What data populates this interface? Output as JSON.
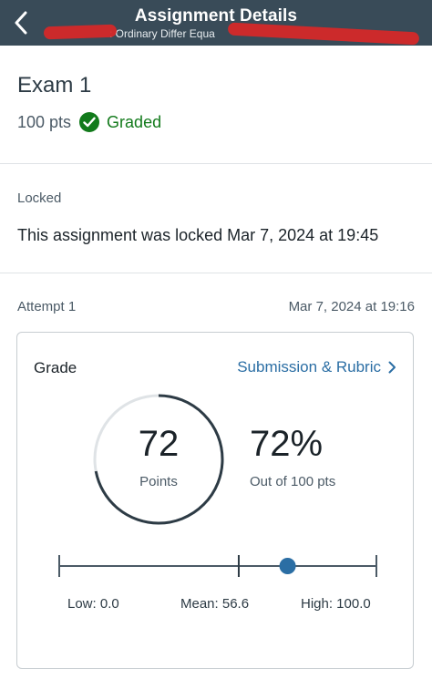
{
  "header": {
    "title": "Assignment Details",
    "subtitle": ": Ordinary Differ Equa",
    "back_icon": "chevron-left-icon"
  },
  "assignment": {
    "name": "Exam 1",
    "points": "100 pts",
    "status": "Graded",
    "status_color": "#127a1b"
  },
  "lock": {
    "label": "Locked",
    "message": "This assignment was locked Mar 7, 2024 at 19:45"
  },
  "attempt": {
    "label": "Attempt 1",
    "date": "Mar 7, 2024 at 19:16"
  },
  "grade_card": {
    "title": "Grade",
    "link_label": "Submission & Rubric",
    "score": "72",
    "score_label": "Points",
    "score_fraction": 0.72,
    "percent": "72%",
    "out_of": "Out of 100 pts",
    "stats": {
      "low_label": "Low: 0.0",
      "mean_label": "Mean: 56.6",
      "high_label": "High: 100.0",
      "low": 0.0,
      "mean": 56.6,
      "high": 100.0,
      "your_score": 72
    },
    "colors": {
      "ring": "#2d3b45",
      "ring_track": "#dfe3e6",
      "marker": "#2b6ea4",
      "link": "#2b6ea4"
    }
  }
}
